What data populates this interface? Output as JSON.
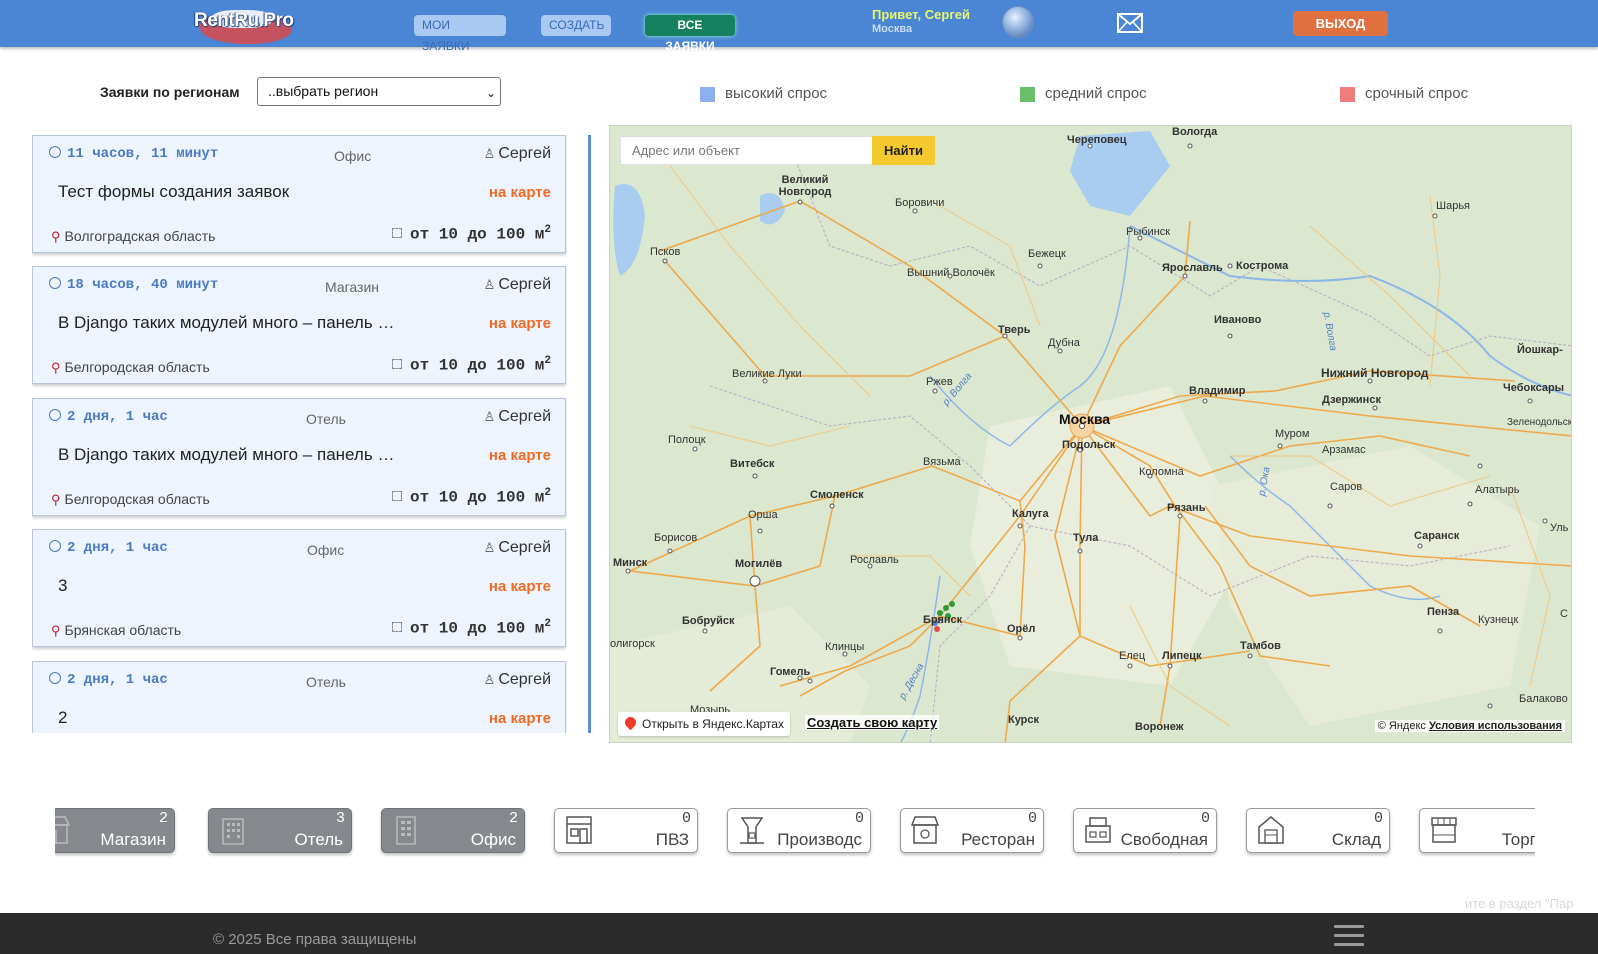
{
  "header": {
    "logo_main": "RentRu",
    "logo_suffix": ".Pro",
    "nav_my": "МОИ ЗАЯВКИ",
    "nav_create": "СОЗДАТЬ",
    "nav_all": "ВСЕ ЗАЯВКИ",
    "greeting": "Привет, Сергей",
    "city": "Москва",
    "exit": "ВЫХОД"
  },
  "filter": {
    "label": "Заявки по регионам",
    "selected": "..выбрать регион"
  },
  "legend": [
    {
      "label": "высокий спрос",
      "color": "#8fb0ee"
    },
    {
      "label": "средний спрос",
      "color": "#6cbf6a"
    },
    {
      "label": "срочный спрос",
      "color": "#f07d7d"
    }
  ],
  "requests": [
    {
      "time": "11 часов, 11 минут",
      "type": "Офис",
      "user": "Сергей",
      "title": "Тест формы создания заявок",
      "on_map": "на карте",
      "region": "Волгоградская область",
      "area": "от 10 до 100 м",
      "area_unit_sup": "2"
    },
    {
      "time": "18 часов, 40 минут",
      "type": "Магазин",
      "user": "Сергей",
      "title": "В Django таких модулей много – панель управления",
      "on_map": "на карте",
      "region": "Белгородская область",
      "area": "от 10 до 100 м",
      "area_unit_sup": "2"
    },
    {
      "time": "2 дня, 1 час",
      "type": "Отель",
      "user": "Сергей",
      "title": "В Django таких модулей много – панель управления",
      "on_map": "на карте",
      "region": "Белгородская область",
      "area": "от 10 до 100 м",
      "area_unit_sup": "2"
    },
    {
      "time": "2 дня, 1 час",
      "type": "Офис",
      "user": "Сергей",
      "title": "3",
      "on_map": "на карте",
      "region": "Брянская область",
      "area": "от 10 до 100 м",
      "area_unit_sup": "2"
    },
    {
      "time": "2 дня, 1 час",
      "type": "Отель",
      "user": "Сергей",
      "title": "2",
      "on_map": "на карте",
      "region": "",
      "area": "",
      "area_unit_sup": ""
    }
  ],
  "map": {
    "search_placeholder": "Адрес или объект",
    "find": "Найти",
    "open_yandex": "Открыть в Яндекс.Картах",
    "create_map": "Создать свою карту",
    "copyright": "© Яндекс",
    "terms": "Условия использования",
    "cities": {
      "moscow": "Москва",
      "podolsk": "Подольск",
      "tver": "Тверь",
      "yaroslavl": "Ярославль",
      "kostroma": "Кострома",
      "vologda": "Вологда",
      "cherepovets": "Череповец",
      "rybinsk": "Рыбинск",
      "bezhetsk": "Бежецк",
      "vyshny": "Вышний Волочёк",
      "borovichi": "Боровичи",
      "novgorod": "Великий Новгород",
      "pskov": "Псков",
      "velikie_luki": "Великие Луки",
      "rzhev": "Ржев",
      "dubna": "Дубна",
      "ivanovo": "Иваново",
      "vladimir": "Владимир",
      "nizhny": "Нижний Новгород",
      "dzerzhinsk": "Дзержинск",
      "sharya": "Шарья",
      "yoshkar": "Йошкар-",
      "cheboksary": "Чебоксары",
      "zelenodolsk": "Зеленодольск",
      "murom": "Муром",
      "arzamas": "Арзамас",
      "kolomna": "Коломна",
      "ryazan": "Рязань",
      "sarov": "Саров",
      "alatyr": "Алатырь",
      "saransk": "Саранск",
      "uly": "Уль",
      "vyazma": "Вязьма",
      "kaluga": "Калуга",
      "tula": "Тула",
      "smolensk": "Смоленск",
      "vitebsk": "Витебск",
      "polotsk": "Полоцк",
      "orsha": "Орша",
      "borisov": "Борисов",
      "minsk": "Минск",
      "mogilev": "Могилёв",
      "roslavl": "Рославль",
      "bryansk": "Брянск",
      "bobruisk": "Бобруйск",
      "soligorsk": "олигорск",
      "gomel": "Гомель",
      "klintsy": "Клинцы",
      "mozyr": "Мозырь",
      "orel": "Орёл",
      "elets": "Елец",
      "lipetsk": "Липецк",
      "tambov": "Тамбов",
      "penza": "Пенза",
      "kuznetsk": "Кузнецк",
      "balakovo": "Балаково",
      "kursk": "Курск",
      "voronezh": "Воронеж",
      "c_edge": "С"
    },
    "rivers": {
      "volga1": "р. Волга",
      "volga2": "р. Волга",
      "oka": "р. Ока",
      "desna": "р. Десна"
    }
  },
  "categories": [
    {
      "label": "Магазин",
      "count": "2",
      "active": true,
      "icon": "shop-icon"
    },
    {
      "label": "Отель",
      "count": "3",
      "active": true,
      "icon": "hotel-icon"
    },
    {
      "label": "Офис",
      "count": "2",
      "active": true,
      "icon": "office-icon"
    },
    {
      "label": "ПВЗ",
      "count": "0",
      "active": false,
      "icon": "pickup-point-icon"
    },
    {
      "label": "Производс",
      "count": "0",
      "active": false,
      "icon": "factory-icon"
    },
    {
      "label": "Ресторан",
      "count": "0",
      "active": false,
      "icon": "restaurant-icon"
    },
    {
      "label": "Свободная",
      "count": "0",
      "active": false,
      "icon": "free-purpose-icon"
    },
    {
      "label": "Склад",
      "count": "0",
      "active": false,
      "icon": "warehouse-icon"
    },
    {
      "label": "Торгов",
      "count": "",
      "active": false,
      "icon": "trade-icon"
    }
  ],
  "footer": {
    "hint": "ите в раздел \"Пар",
    "copyright": "© 2025 Все права защищены"
  }
}
